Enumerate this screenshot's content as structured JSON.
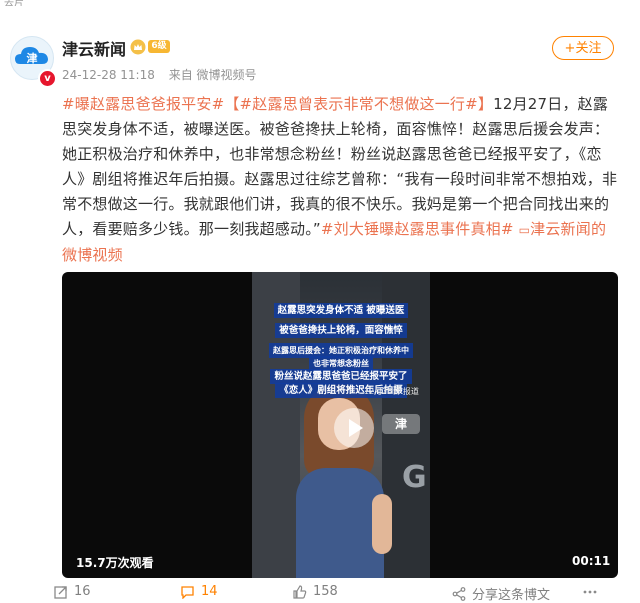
{
  "top_strip": {
    "text": "去片"
  },
  "author": {
    "name": "津云新闻",
    "avatar_glyph": "津",
    "verified_mark": "v",
    "vip_badge": "6级",
    "timestamp": "24-12-28 11:18",
    "source": "来自 微博视频号"
  },
  "follow_button": {
    "label": "+关注"
  },
  "post": {
    "tag1": "#曝赵露思爸爸报平安#",
    "tag2": "【#赵露思曾表示非常不想做这一行#】",
    "body": "12月27日，赵露思突发身体不适，被曝送医。被爸爸搀扶上轮椅，面容憔悴！赵露思后援会发声：她正积极治疗和休养中，也非常想念粉丝！粉丝说赵露思爸爸已经报平安了，《恋人》剧组将推迟年后拍摄。赵露思过往综艺曾称：“我有一段时间非常不想拍戏，非常不想做这一行。我就跟他们讲，我真的很不快乐。我妈是第一个把合同找出来的人，看要赔多少钱。那一刻我超感动。”",
    "tag3": "#刘大锤曝赵露思事件真相#",
    "link_icon": "▭",
    "link_text": "津云新闻的微博视频"
  },
  "video": {
    "captions": [
      "赵露思突发身体不适 被曝送医",
      "被爸爸搀扶上轮椅，面容憔悴",
      "赵露思后援会：她正积极治疗和休养中",
      "也非常想念粉丝",
      "粉丝说赵露思爸爸已经报平安了",
      "《恋人》剧组将推迟年后拍摄"
    ],
    "date_caption": "12月28日 报道",
    "frame_logo": "津",
    "view_count": "15.7万次观看",
    "duration": "00:11"
  },
  "actions": {
    "repost_count": "16",
    "comment_count": "14",
    "like_count": "158",
    "share_label": "分享这条博文"
  },
  "colors": {
    "accent": "#ff8200",
    "tag": "#eb7350",
    "caption_bg": "#103ca0"
  }
}
